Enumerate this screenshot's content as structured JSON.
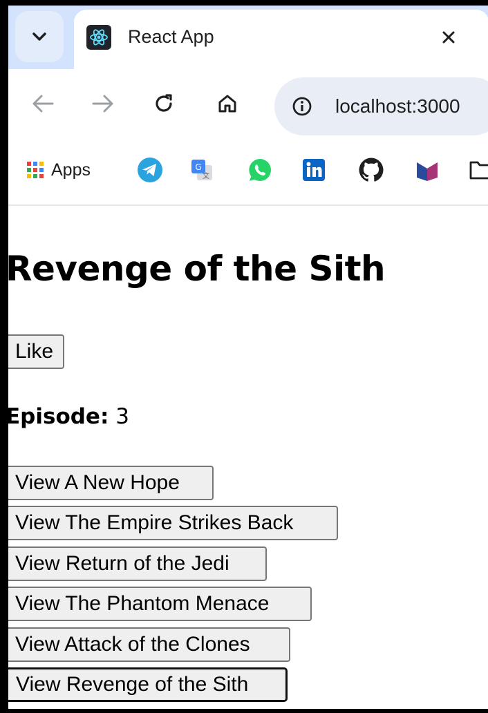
{
  "browser": {
    "tab": {
      "title": "React App"
    },
    "address_bar": {
      "url": "localhost:3000"
    },
    "bookmarks": {
      "apps_label": "Apps"
    }
  },
  "page": {
    "title": "Revenge of the Sith",
    "like_label": "Like",
    "episode": {
      "label": "Episode:",
      "value": "3"
    },
    "movie_buttons": [
      "View A New Hope",
      "View The Empire Strikes Back",
      "View Return of the Jedi",
      "View The Phantom Menace",
      "View Attack of the Clones",
      "View Revenge of the Sith"
    ]
  },
  "colors": {
    "tabstrip_bg": "#d3e3fd",
    "omnibox_bg": "#e9eef6",
    "button_bg": "#efefef",
    "react_logo": "#61dafb"
  }
}
